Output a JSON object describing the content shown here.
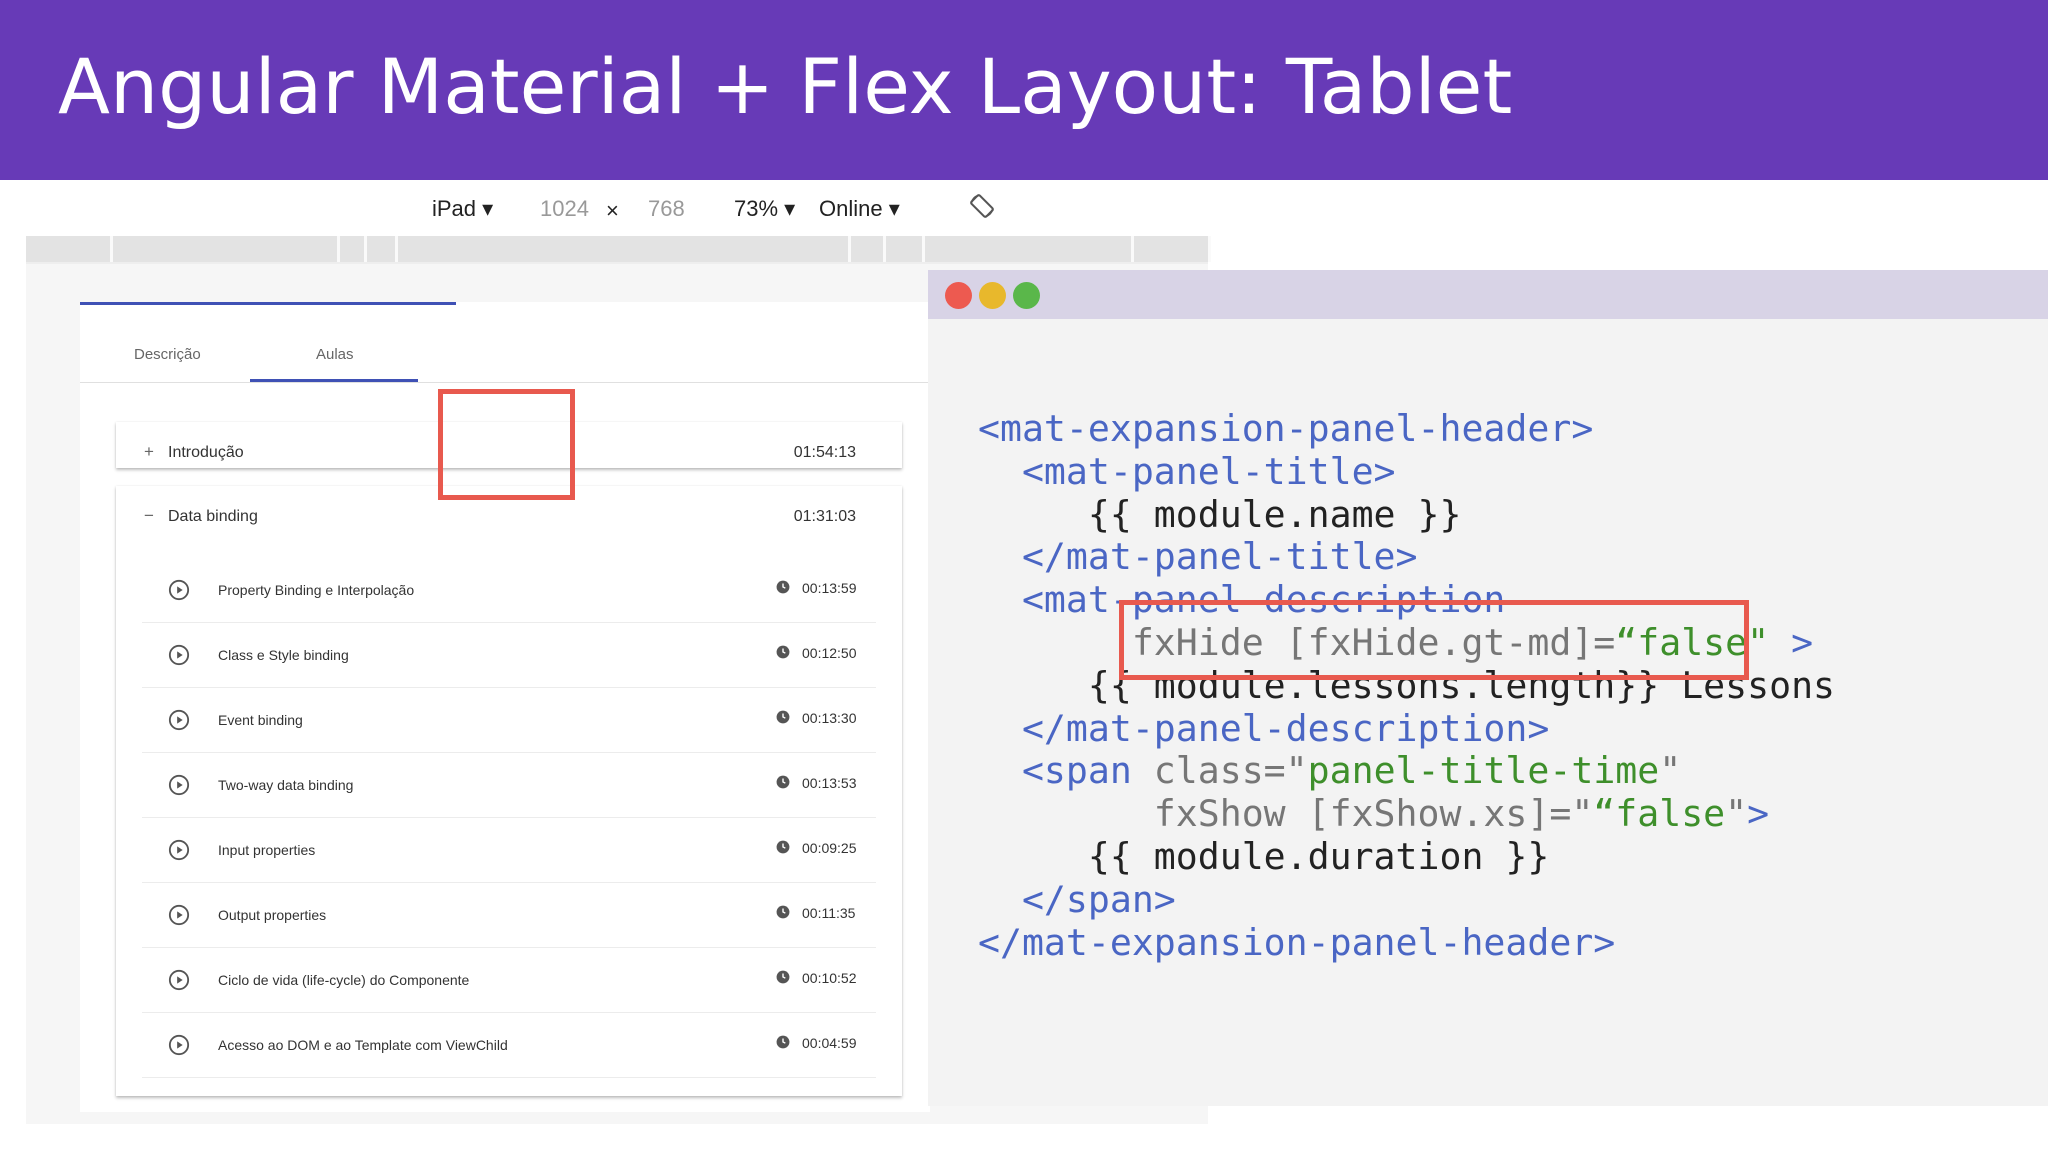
{
  "slide": {
    "title": "Angular Material + Flex Layout: Tablet"
  },
  "device_toolbar": {
    "device": "iPad",
    "width": "1024",
    "times": "×",
    "height": "768",
    "zoom": "73%",
    "network": "Online",
    "rotate_icon": "rotate-device-icon"
  },
  "tabs": [
    {
      "label": "Descrição",
      "active": false
    },
    {
      "label": "Aulas",
      "active": true
    }
  ],
  "modules": [
    {
      "toggle": "+",
      "title": "Introdução",
      "duration": "01:54:13",
      "expanded": false
    },
    {
      "toggle": "−",
      "title": "Data binding",
      "duration": "01:31:03",
      "expanded": true
    }
  ],
  "lessons": [
    {
      "name": "Property Binding e Interpolação",
      "duration": "00:13:59"
    },
    {
      "name": "Class e Style binding",
      "duration": "00:12:50"
    },
    {
      "name": "Event binding",
      "duration": "00:13:30"
    },
    {
      "name": "Two-way data binding",
      "duration": "00:13:53"
    },
    {
      "name": "Input properties",
      "duration": "00:09:25"
    },
    {
      "name": "Output properties",
      "duration": "00:11:35"
    },
    {
      "name": "Ciclo de vida (life-cycle) do Componente",
      "duration": "00:10:52"
    },
    {
      "name": "Acesso ao DOM e ao Template com ViewChild",
      "duration": "00:04:59"
    }
  ],
  "code_window": {
    "dot_colors": [
      "#ed5a50",
      "#e8b82c",
      "#5ab74a"
    ],
    "lines": [
      [
        {
          "t": "<mat-expansion-panel-header>",
          "c": "tag"
        }
      ],
      [
        {
          "t": "  <mat-panel-title>",
          "c": "tag"
        }
      ],
      [
        {
          "t": "     {{ module.name }}",
          "c": "txt"
        }
      ],
      [
        {
          "t": "  </mat-panel-title>",
          "c": "tag"
        }
      ],
      [
        {
          "t": "  <mat-panel-description",
          "c": "tag"
        }
      ],
      [
        {
          "t": "       fxHide [fxHide.gt-md]=",
          "c": "attr"
        },
        {
          "t": "“false\"",
          "c": "str"
        },
        {
          "t": " >",
          "c": "tag"
        }
      ],
      [
        {
          "t": "     {{ module.lessons.length}} Lessons",
          "c": "txt"
        }
      ],
      [
        {
          "t": "  </mat-panel-description>",
          "c": "tag"
        }
      ],
      [
        {
          "t": "  <span",
          "c": "tag"
        },
        {
          "t": " class=\"",
          "c": "attr"
        },
        {
          "t": "panel-title-time",
          "c": "str"
        },
        {
          "t": "\"",
          "c": "attr"
        }
      ],
      [
        {
          "t": "        fxShow [fxShow.xs]=\"",
          "c": "attr"
        },
        {
          "t": "“false",
          "c": "str"
        },
        {
          "t": "\"",
          "c": "attr"
        },
        {
          "t": ">",
          "c": "tag"
        }
      ],
      [
        {
          "t": "     {{ module.duration }}",
          "c": "txt"
        }
      ],
      [
        {
          "t": "  </span>",
          "c": "tag"
        }
      ],
      [
        {
          "t": "</mat-expansion-panel-header>",
          "c": "tag"
        }
      ]
    ]
  },
  "highlight_color": "#e8594e"
}
